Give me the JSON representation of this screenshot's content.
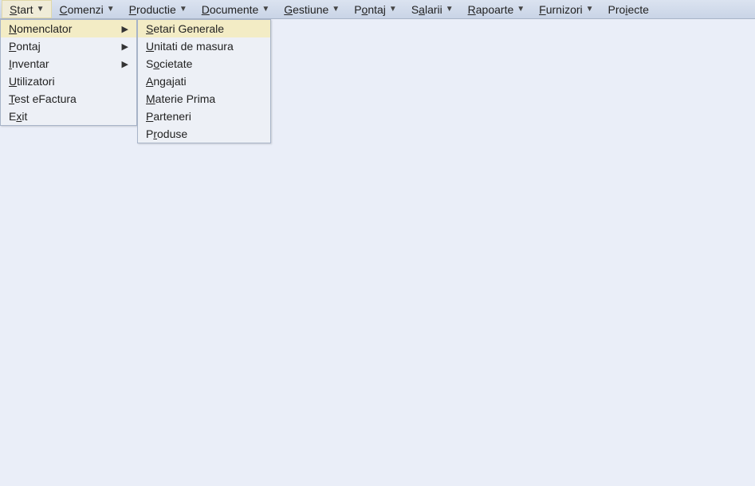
{
  "menubar": {
    "items": [
      {
        "pre": "",
        "ul": "S",
        "post": "tart",
        "has_arrow": true,
        "active": true
      },
      {
        "pre": "",
        "ul": "C",
        "post": "omenzi",
        "has_arrow": true
      },
      {
        "pre": "",
        "ul": "P",
        "post": "roductie",
        "has_arrow": true
      },
      {
        "pre": "",
        "ul": "D",
        "post": "ocumente",
        "has_arrow": true
      },
      {
        "pre": "",
        "ul": "G",
        "post": "estiune",
        "has_arrow": true
      },
      {
        "pre": "P",
        "ul": "o",
        "post": "ntaj",
        "has_arrow": true
      },
      {
        "pre": "S",
        "ul": "a",
        "post": "larii",
        "has_arrow": true
      },
      {
        "pre": "",
        "ul": "R",
        "post": "apoarte",
        "has_arrow": true
      },
      {
        "pre": "",
        "ul": "F",
        "post": "urnizori",
        "has_arrow": true
      },
      {
        "pre": "Pro",
        "ul": "i",
        "post": "ecte",
        "has_arrow": false
      }
    ]
  },
  "dropdown": {
    "items": [
      {
        "pre": "",
        "ul": "N",
        "post": "omenclator",
        "has_caret": true,
        "highlight": true
      },
      {
        "pre": "",
        "ul": "P",
        "post": "ontaj",
        "has_caret": true
      },
      {
        "pre": "",
        "ul": "I",
        "post": "nventar",
        "has_caret": true
      },
      {
        "pre": "",
        "ul": "U",
        "post": "tilizatori",
        "has_caret": false
      },
      {
        "pre": "",
        "ul": "T",
        "post": "est eFactura",
        "has_caret": false
      },
      {
        "pre": "E",
        "ul": "x",
        "post": "it",
        "has_caret": false
      }
    ]
  },
  "submenu": {
    "items": [
      {
        "pre": "",
        "ul": "S",
        "post": "etari Generale",
        "highlight": true
      },
      {
        "pre": "",
        "ul": "U",
        "post": "nitati de masura"
      },
      {
        "pre": "S",
        "ul": "o",
        "post": "cietate"
      },
      {
        "pre": "",
        "ul": "A",
        "post": "ngajati"
      },
      {
        "pre": "",
        "ul": "M",
        "post": "aterie Prima"
      },
      {
        "pre": "",
        "ul": "P",
        "post": "arteneri"
      },
      {
        "pre": "P",
        "ul": "r",
        "post": "oduse"
      }
    ]
  },
  "icons": {
    "down_arrow": "▼",
    "right_caret": "▶"
  }
}
